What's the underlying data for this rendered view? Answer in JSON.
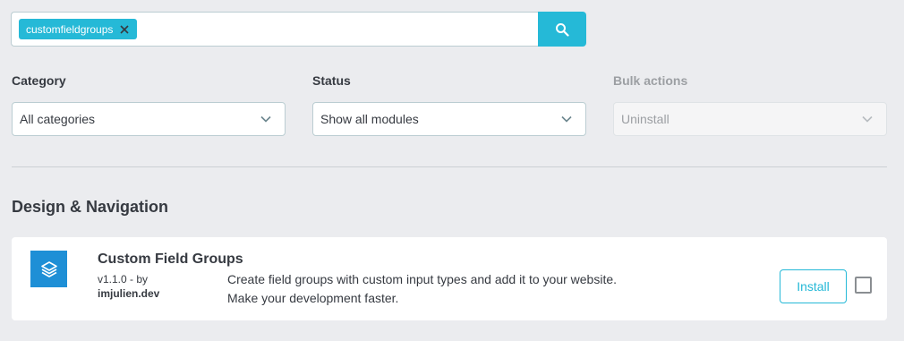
{
  "search": {
    "tag_label": "customfieldgroups",
    "value": "",
    "placeholder": ""
  },
  "filters": {
    "category": {
      "label": "Category",
      "value": "All categories"
    },
    "status": {
      "label": "Status",
      "value": "Show all modules"
    },
    "bulk": {
      "label": "Bulk actions",
      "value": "Uninstall",
      "disabled": true
    }
  },
  "section": {
    "title": "Design & Navigation"
  },
  "module": {
    "name": "Custom Field Groups",
    "version_by": "v1.1.0 - by",
    "author": "imjulien.dev",
    "description_line1": "Create field groups with custom input types and add it to your website.",
    "description_line2": "Make your development faster.",
    "install_label": "Install",
    "logo_icon": "layers-icon"
  },
  "colors": {
    "accent": "#25b9d7",
    "logo": "#1e8fd6",
    "background": "#ebecef"
  }
}
